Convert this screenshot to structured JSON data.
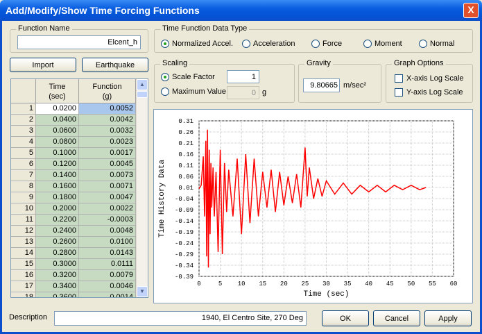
{
  "window": {
    "title": "Add/Modify/Show Time Forcing Functions",
    "close": "X"
  },
  "function_name": {
    "label": "Function Name",
    "value": "Elcent_h"
  },
  "buttons": {
    "import": "Import",
    "earthquake": "Earthquake",
    "ok": "OK",
    "cancel": "Cancel",
    "apply": "Apply"
  },
  "data_type": {
    "label": "Time Function Data Type",
    "options": [
      "Normalized Accel.",
      "Acceleration",
      "Force",
      "Moment",
      "Normal"
    ],
    "selected": "Normalized Accel."
  },
  "scaling": {
    "label": "Scaling",
    "scale_factor_label": "Scale Factor",
    "scale_factor_value": "1",
    "max_value_label": "Maximum Value",
    "max_value_value": "0",
    "max_value_unit": "g",
    "selected": "Scale Factor"
  },
  "gravity": {
    "label": "Gravity",
    "value": "9.80665",
    "unit": "m/sec²"
  },
  "graph_options": {
    "label": "Graph Options",
    "x_log": "X-axis Log Scale",
    "y_log": "Y-axis Log Scale",
    "x_log_checked": false,
    "y_log_checked": false
  },
  "table": {
    "col_time": "Time",
    "col_time_unit": "(sec)",
    "col_func": "Function",
    "col_func_unit": "(g)",
    "rows": [
      [
        "1",
        "0.0200",
        "0.0052"
      ],
      [
        "2",
        "0.0400",
        "0.0042"
      ],
      [
        "3",
        "0.0600",
        "0.0032"
      ],
      [
        "4",
        "0.0800",
        "0.0023"
      ],
      [
        "5",
        "0.1000",
        "0.0017"
      ],
      [
        "6",
        "0.1200",
        "0.0045"
      ],
      [
        "7",
        "0.1400",
        "0.0073"
      ],
      [
        "8",
        "0.1600",
        "0.0071"
      ],
      [
        "9",
        "0.1800",
        "0.0047"
      ],
      [
        "10",
        "0.2000",
        "0.0022"
      ],
      [
        "11",
        "0.2200",
        "-0.0003"
      ],
      [
        "12",
        "0.2400",
        "0.0048"
      ],
      [
        "13",
        "0.2600",
        "0.0100"
      ],
      [
        "14",
        "0.2800",
        "0.0143"
      ],
      [
        "15",
        "0.3000",
        "0.0111"
      ],
      [
        "16",
        "0.3200",
        "0.0079"
      ],
      [
        "17",
        "0.3400",
        "0.0046"
      ],
      [
        "18",
        "0.3600",
        "0.0014"
      ]
    ]
  },
  "description": {
    "label": "Description",
    "value": "1940, El Centro Site, 270 Deg"
  },
  "chart_data": {
    "type": "line",
    "xlabel": "Time (sec)",
    "ylabel": "Time History Data",
    "xlim": [
      0,
      60
    ],
    "ylim": [
      -0.39,
      0.31
    ],
    "xticks": [
      "0",
      "5",
      "10",
      "15",
      "20",
      "25",
      "30",
      "35",
      "40",
      "45",
      "50",
      "55",
      "60"
    ],
    "yticks": [
      "0.31",
      "0.26",
      "0.21",
      "0.16",
      "0.11",
      "0.06",
      "0.01",
      "-0.04",
      "-0.09",
      "-0.14",
      "-0.19",
      "-0.24",
      "-0.29",
      "-0.34",
      "-0.39"
    ],
    "grid": true,
    "color": "#ff0000",
    "series": [
      {
        "x": [
          0,
          0.5,
          1,
          1.3,
          1.6,
          1.8,
          2,
          2.2,
          2.4,
          2.6,
          2.8,
          3,
          3.3,
          3.6,
          4,
          4.5,
          5,
          5.5,
          6,
          6.5,
          7,
          8,
          9,
          10,
          11,
          12,
          13,
          14,
          15,
          16,
          17,
          18,
          19,
          20,
          21,
          22,
          23,
          24,
          25,
          25.5,
          26,
          27,
          28,
          29,
          30,
          32,
          34,
          36,
          38,
          40,
          42,
          44,
          46,
          48,
          50,
          52,
          53.5
        ],
        "y": [
          0.005,
          0.02,
          0.15,
          -0.12,
          0.22,
          -0.3,
          0.27,
          -0.35,
          0.18,
          -0.2,
          0.12,
          -0.08,
          0.1,
          -0.12,
          0.08,
          -0.28,
          0.18,
          -0.29,
          0.12,
          -0.1,
          0.09,
          -0.12,
          0.14,
          -0.2,
          0.16,
          -0.15,
          0.14,
          -0.12,
          0.08,
          -0.08,
          0.09,
          -0.1,
          0.08,
          -0.07,
          0.06,
          -0.06,
          0.07,
          -0.08,
          0.19,
          -0.03,
          0.1,
          -0.04,
          0.05,
          -0.03,
          0.04,
          -0.02,
          0.03,
          -0.02,
          0.02,
          -0.01,
          0.02,
          -0.01,
          0.02,
          0.0,
          0.02,
          0.0,
          0.01
        ]
      }
    ]
  }
}
